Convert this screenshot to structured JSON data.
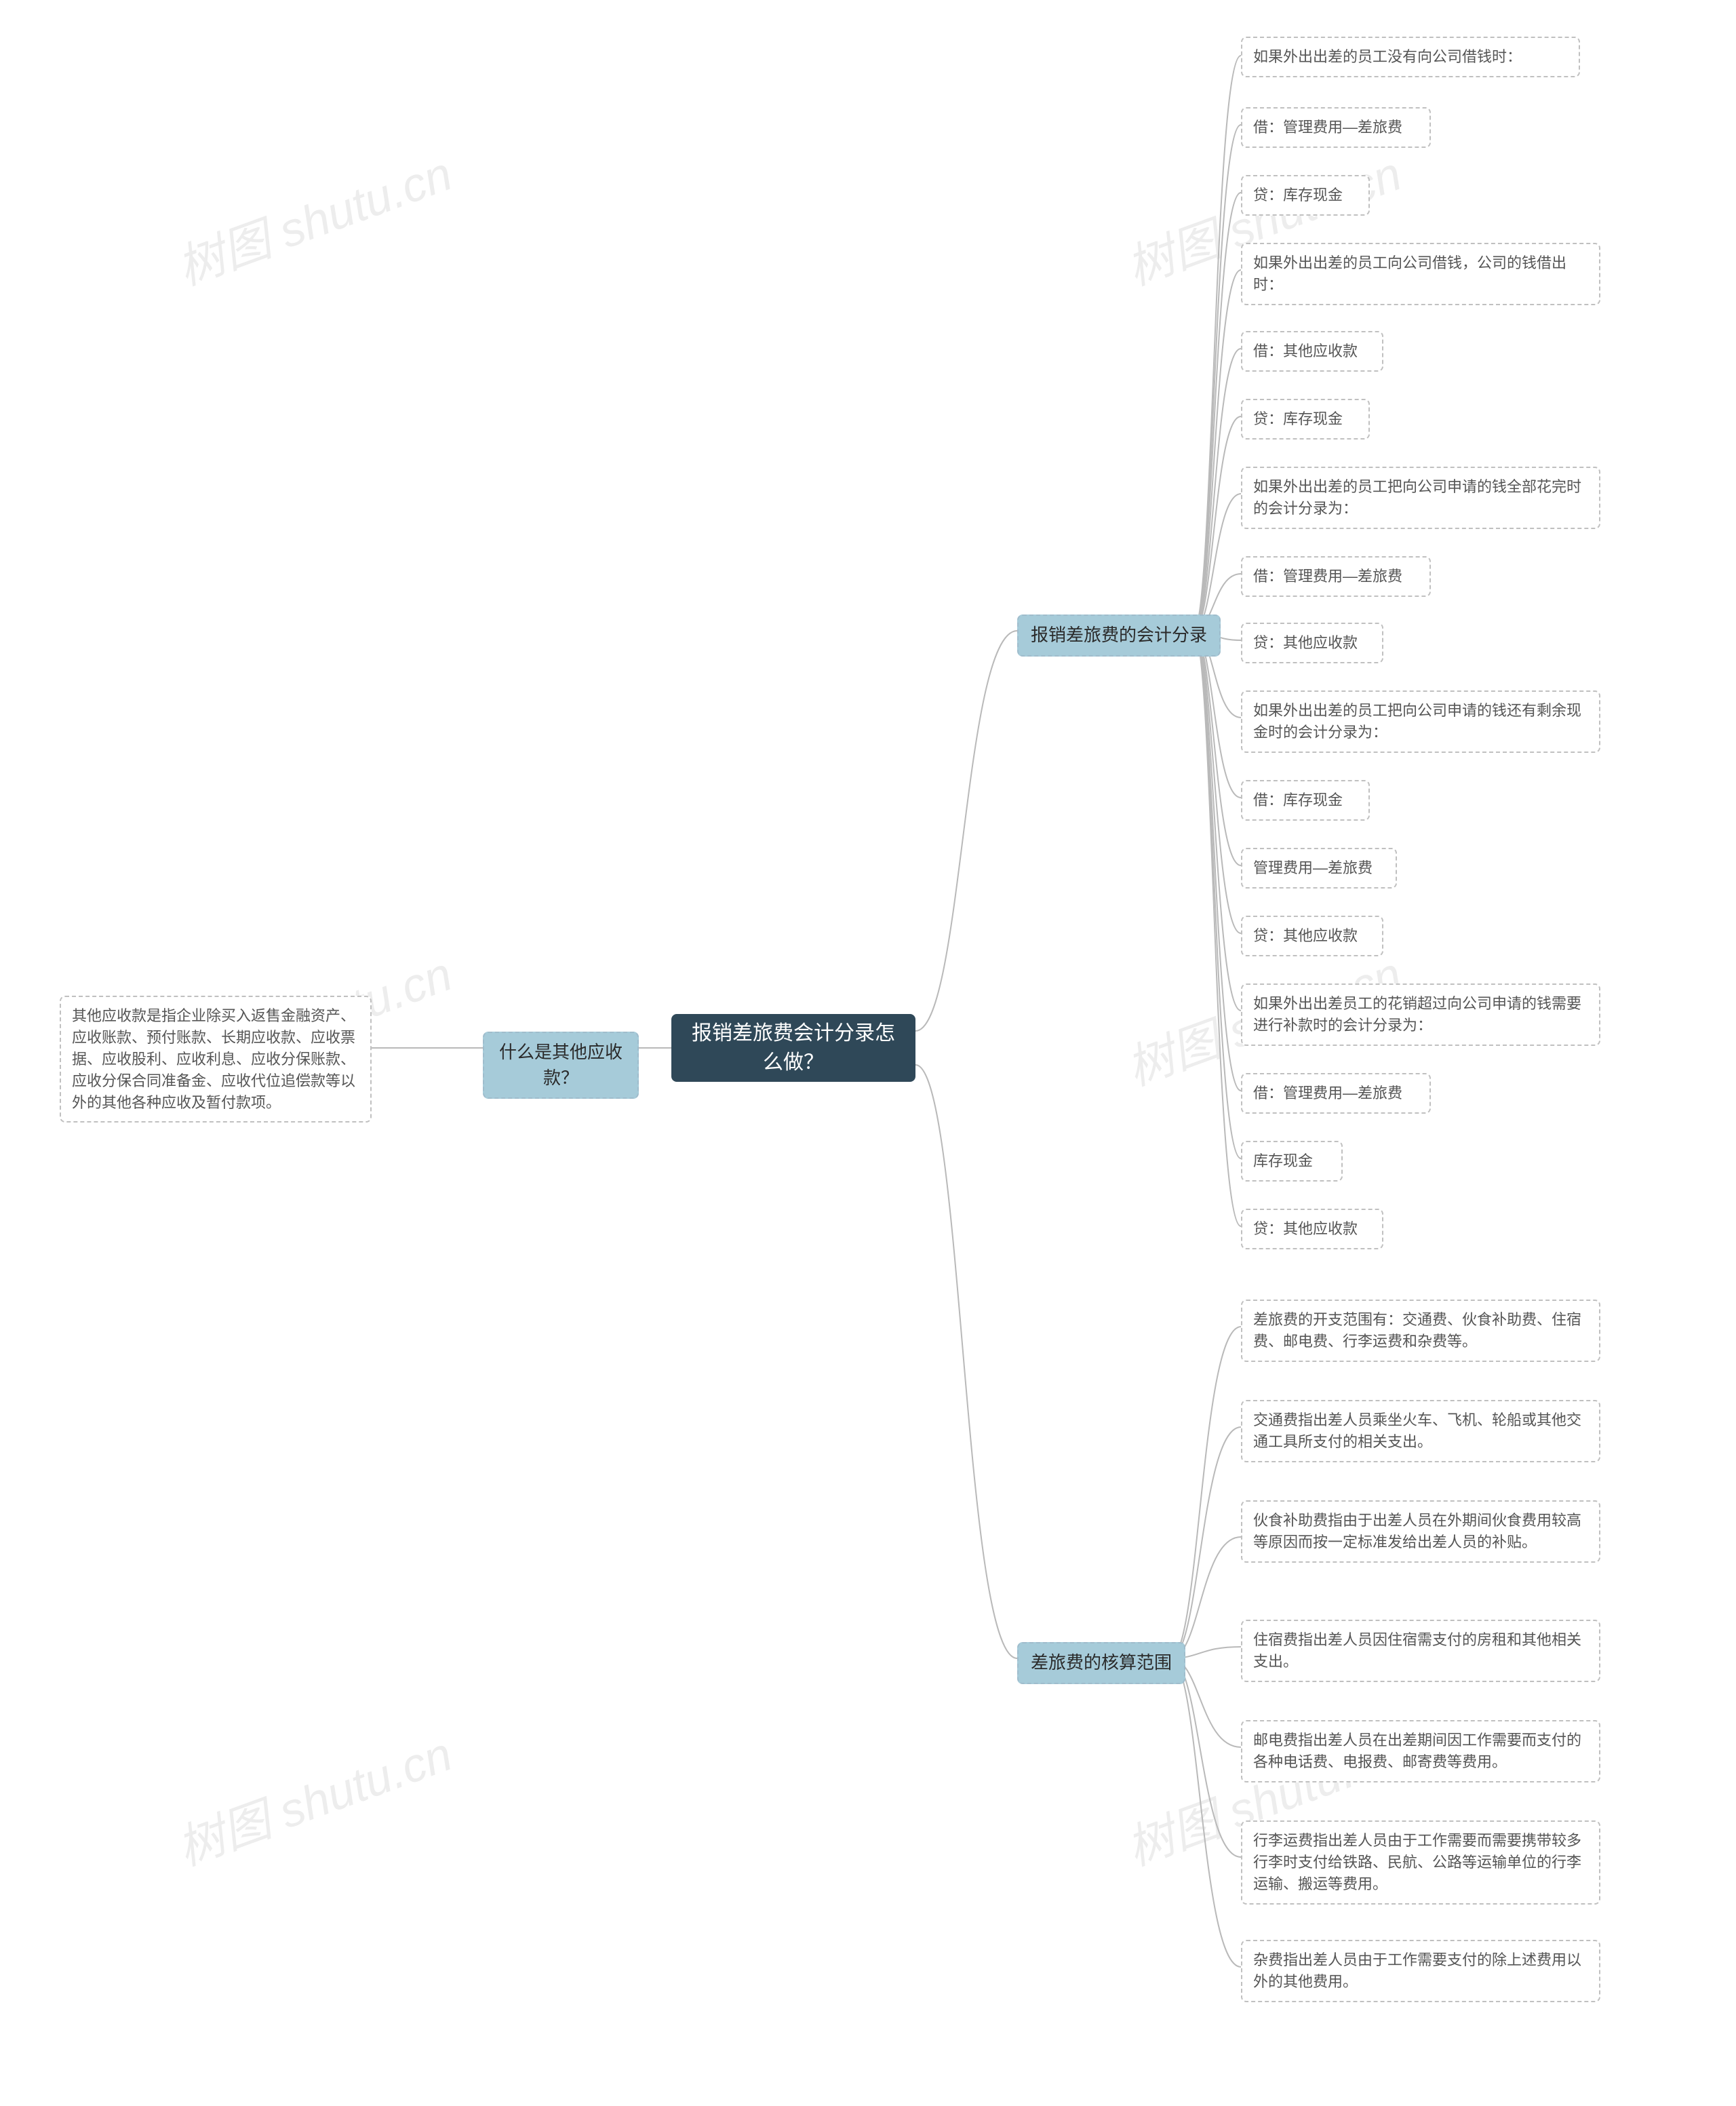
{
  "root": "报销差旅费会计分录怎么做？",
  "watermark": "树图 shutu.cn",
  "branches": {
    "b1": {
      "label": "报销差旅费的会计分录"
    },
    "b2": {
      "label": "差旅费的核算范围"
    },
    "b3": {
      "label": "什么是其他应收款？"
    }
  },
  "leaves": {
    "r1_0": "如果外出出差的员工没有向公司借钱时：",
    "r1_1": "借：管理费用—差旅费",
    "r1_2": "贷：库存现金",
    "r1_3": "如果外出出差的员工向公司借钱，公司的钱借出时：",
    "r1_4": "借：其他应收款",
    "r1_5": "贷：库存现金",
    "r1_6": "如果外出出差的员工把向公司申请的钱全部花完时的会计分录为：",
    "r1_7": "借：管理费用—差旅费",
    "r1_8": "贷：其他应收款",
    "r1_9": "如果外出出差的员工把向公司申请的钱还有剩余现金时的会计分录为：",
    "r1_10": "借：库存现金",
    "r1_11": "管理费用—差旅费",
    "r1_12": "贷：其他应收款",
    "r1_13": "如果外出出差员工的花销超过向公司申请的钱需要进行补款时的会计分录为：",
    "r1_14": "借：管理费用—差旅费",
    "r1_15": "库存现金",
    "r1_16": "贷：其他应收款",
    "r2_0": "差旅费的开支范围有：交通费、伙食补助费、住宿费、邮电费、行李运费和杂费等。",
    "r2_1": "交通费指出差人员乘坐火车、飞机、轮船或其他交通工具所支付的相关支出。",
    "r2_2": "伙食补助费指由于出差人员在外期间伙食费用较高等原因而按一定标准发给出差人员的补贴。",
    "r2_3": "住宿费指出差人员因住宿需支付的房租和其他相关支出。",
    "r2_4": "邮电费指出差人员在出差期间因工作需要而支付的各种电话费、电报费、邮寄费等费用。",
    "r2_5": "行李运费指出差人员由于工作需要而需要携带较多行李时支付给铁路、民航、公路等运输单位的行李运输、搬运等费用。",
    "r2_6": "杂费指出差人员由于工作需要支付的除上述费用以外的其他费用。",
    "l1_0": "其他应收款是指企业除买入返售金融资产、应收账款、预付账款、长期应收款、应收票据、应收股利、应收利息、应收分保账款、应收分保合同准备金、应收代位追偿款等以外的其他各种应收及暂付款项。"
  }
}
